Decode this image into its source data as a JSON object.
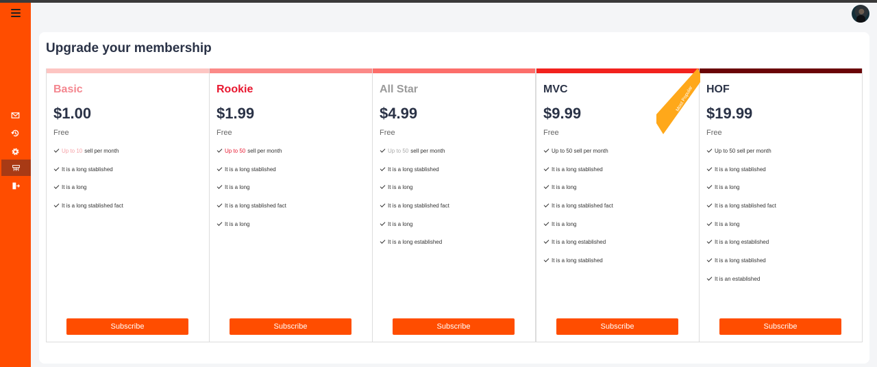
{
  "page": {
    "title": "Upgrade your membership"
  },
  "sidebar": {
    "background": "#ff4d00",
    "menu_icon": "hamburger-icon",
    "items": [
      {
        "icon": "mail-icon",
        "active": false
      },
      {
        "icon": "history-icon",
        "active": false
      },
      {
        "icon": "gear-icon",
        "active": false
      },
      {
        "icon": "membership-icon",
        "active": true
      },
      {
        "icon": "logout-icon",
        "active": false
      }
    ]
  },
  "header": {
    "avatar_icon": "user-avatar"
  },
  "plans": [
    {
      "name": "Basic",
      "name_color": "#f4868f",
      "bar_color": "#fdc5c2",
      "price": "$1.00",
      "price_note": "Free",
      "features": [
        {
          "highlight": "Up to 10",
          "highlight_color": "#f5a0a6",
          "text": "sell per month"
        },
        {
          "text": "It is a long stablished"
        },
        {
          "text": "It is a long"
        },
        {
          "text": "It is a long stablished fact"
        }
      ],
      "button": "Subscribe"
    },
    {
      "name": "Rookie",
      "name_color": "#e8172f",
      "bar_color": "#fb8a88",
      "price": "$1.99",
      "price_note": "Free",
      "features": [
        {
          "highlight": "Up to 50",
          "highlight_color": "#e8172f",
          "text": "sell per month"
        },
        {
          "text": "It is a long stablished"
        },
        {
          "text": "It is a long"
        },
        {
          "text": "It is a long stablished fact"
        },
        {
          "text": "It is a long"
        }
      ],
      "button": "Subscribe"
    },
    {
      "name": "All Star",
      "name_color": "#9a9a9a",
      "bar_color": "#fc6e6a",
      "price": "$4.99",
      "price_note": "Free",
      "features": [
        {
          "highlight": "Up to 50",
          "highlight_color": "#a9a9a9",
          "text": "sell per month"
        },
        {
          "text": "It is a long stablished"
        },
        {
          "text": "It is a long"
        },
        {
          "text": "It is a long stablished fact"
        },
        {
          "text": "It is a long"
        },
        {
          "text": "It is a long established"
        }
      ],
      "button": "Subscribe"
    },
    {
      "name": "MVC",
      "name_color": "#2a3246",
      "bar_color": "#f2221e",
      "price": "$9.99",
      "price_note": "Free",
      "features": [
        {
          "text": "Up to 50 sell per month"
        },
        {
          "text": "It is a long stablished"
        },
        {
          "text": "It is a long"
        },
        {
          "text": "It is a long stablished fact"
        },
        {
          "text": "It is a long"
        },
        {
          "text": "It is a long established"
        },
        {
          "text": "It is a long stablished"
        }
      ],
      "button": "Subscribe",
      "ribbon": {
        "text": "Most Popular",
        "color": "#ffa81a"
      }
    },
    {
      "name": "HOF",
      "name_color": "#2a3246",
      "bar_color": "#6a0407",
      "price": "$19.99",
      "price_note": "Free",
      "features": [
        {
          "text": "Up to 50 sell per month"
        },
        {
          "text": "It is a long stablished"
        },
        {
          "text": "It is a long"
        },
        {
          "text": "It is a long stablished fact"
        },
        {
          "text": "It is a long"
        },
        {
          "text": "It is a long established"
        },
        {
          "text": "It is a long stablished"
        },
        {
          "text": "It is an established"
        }
      ],
      "button": "Subscribe"
    }
  ]
}
